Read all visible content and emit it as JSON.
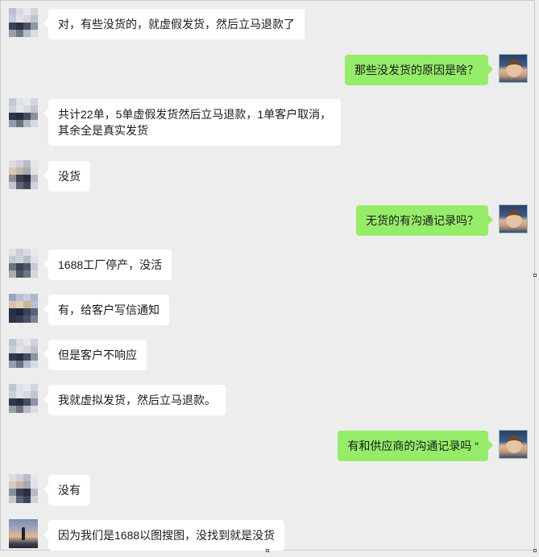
{
  "messages": [
    {
      "side": "in",
      "text": "对，有些没货的，就虚假发货，然后立马退款了"
    },
    {
      "side": "out",
      "text": "那些没发货的原因是啥？"
    },
    {
      "side": "in",
      "text": "共计22单，5单虚假发货然后立马退款，1单客户取消，\n其余全是真实发货"
    },
    {
      "side": "in",
      "text": "没货"
    },
    {
      "side": "out",
      "text": "无货的有沟通记录吗？"
    },
    {
      "side": "in",
      "text": "1688工厂停产，没活"
    },
    {
      "side": "in",
      "text": "有，给客户写信通知"
    },
    {
      "side": "in",
      "text": "但是客户不响应"
    },
    {
      "side": "in",
      "text": "我就虚拟发货，然后立马退款。"
    },
    {
      "side": "out",
      "text": "有和供应商的沟通记录吗 “"
    },
    {
      "side": "in",
      "text": "没有"
    },
    {
      "side": "in",
      "text": "因为我们是1688以图搜图，没找到就是没货"
    }
  ],
  "colors": {
    "background": "#ededed",
    "incoming_bubble": "#ffffff",
    "outgoing_bubble": "#95ec69"
  }
}
